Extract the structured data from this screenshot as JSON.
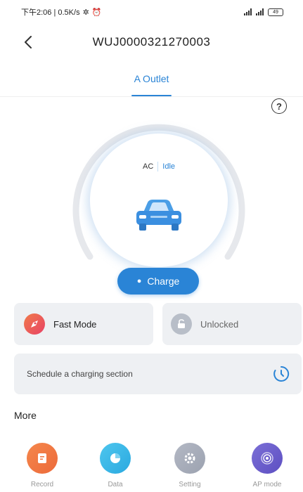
{
  "status_bar": {
    "left_text": "下午2:06 | 0.5K/s",
    "battery_level": "49"
  },
  "header": {
    "device_id": "WUJ0000321270003"
  },
  "tabs": [
    {
      "label": "A Outlet",
      "active": true
    }
  ],
  "gauge": {
    "type": "AC",
    "state": "Idle",
    "accent_color": "#2a84d6"
  },
  "charge_button": {
    "label": "Charge",
    "icon": "bolt-icon"
  },
  "mode_card": {
    "label": "Fast Mode",
    "icon": "rocket-icon"
  },
  "lock_card": {
    "label": "Unlocked",
    "icon": "unlock-icon"
  },
  "schedule_card": {
    "label": "Schedule a charging section",
    "icon": "timer-icon"
  },
  "more": {
    "title": "More",
    "items": [
      {
        "label": "Record",
        "icon": "record-icon",
        "color": "#f07a45"
      },
      {
        "label": "Data",
        "icon": "pie-chart-icon",
        "color": "#3bb8e8"
      },
      {
        "label": "Setting",
        "icon": "gear-icon",
        "color": "#a8aebb"
      },
      {
        "label": "AP mode",
        "icon": "wifi-signal-icon",
        "color": "#6a5dcc"
      }
    ]
  }
}
